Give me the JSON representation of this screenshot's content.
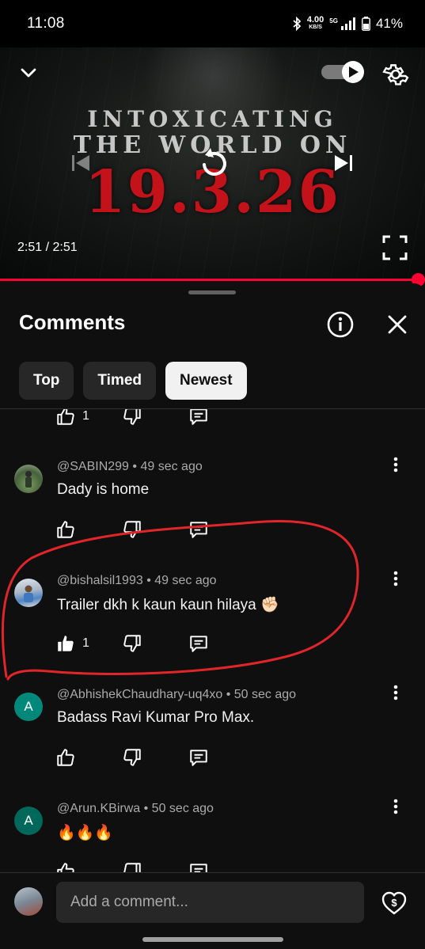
{
  "status_bar": {
    "time": "11:08",
    "net_speed_value": "4.00",
    "net_speed_unit": "KB/S",
    "network": "5G",
    "battery": "41%"
  },
  "video": {
    "poster_line1": "INTOXICATING",
    "poster_line2": "THE WORLD ON",
    "poster_date": "19.3.26",
    "time_display": "2:51 / 2:51",
    "progress": 1.0,
    "accent_color": "#ff0033"
  },
  "comments_panel": {
    "title": "Comments",
    "chips": [
      {
        "label": "Top",
        "selected": false
      },
      {
        "label": "Timed",
        "selected": false
      },
      {
        "label": "Newest",
        "selected": true
      }
    ]
  },
  "partial_row": {
    "like_count": "1"
  },
  "comments": [
    {
      "author": "@SABIN299",
      "time": "49 sec ago",
      "text": "Dady is home",
      "like_count": "",
      "avatar": {
        "type": "photo",
        "color": "#3f5a3a"
      }
    },
    {
      "author": "@bishalsil1993",
      "time": "49 sec ago",
      "text": "Trailer dkh k kaun kaun hilaya ✊🏻",
      "like_count": "1",
      "liked": true,
      "avatar": {
        "type": "photo",
        "color": "#9aa6b4"
      }
    },
    {
      "author": "@AbhishekChaudhary-uq4xo",
      "time": "50 sec ago",
      "text": "Badass Ravi Kumar Pro Max.",
      "like_count": "",
      "avatar": {
        "type": "letter",
        "letter": "A",
        "color": "#00897b"
      }
    },
    {
      "author": "@Arun.KBirwa",
      "time": "50 sec ago",
      "text": "🔥🔥🔥",
      "like_count": "",
      "avatar": {
        "type": "letter",
        "letter": "A",
        "color": "#00695c"
      }
    }
  ],
  "composer": {
    "placeholder": "Add a comment..."
  },
  "icons": {
    "collapse": "chevron-down-icon",
    "autoplay": "autoplay-toggle-icon",
    "settings": "gear-icon",
    "previous": "skip-previous-icon",
    "replay": "replay-icon",
    "next": "skip-next-icon",
    "fullscreen": "fullscreen-icon",
    "info": "info-icon",
    "close": "close-icon",
    "like": "thumbs-up-icon",
    "dislike": "thumbs-down-icon",
    "reply": "reply-icon",
    "more": "more-vert-icon",
    "thanks": "super-thanks-icon"
  },
  "annotation_color": "#e0252b"
}
